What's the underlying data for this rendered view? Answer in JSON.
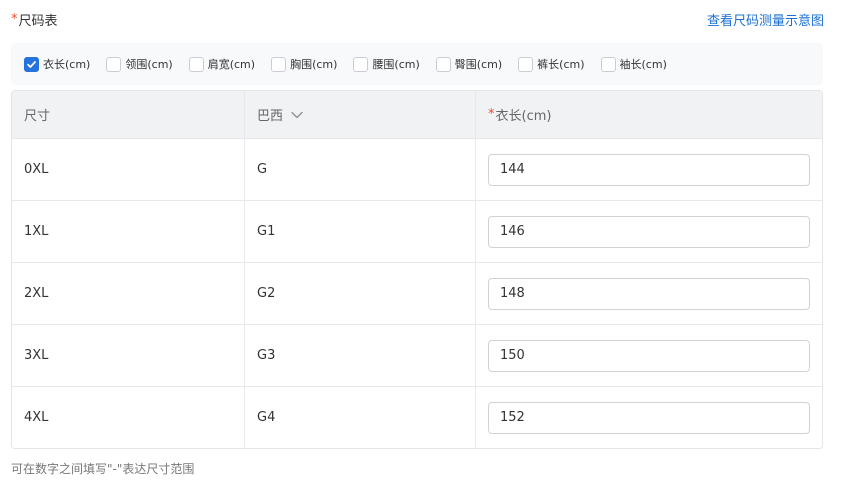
{
  "header": {
    "required_mark": "*",
    "title": "尺码表",
    "help_link": "查看尺码测量示意图"
  },
  "measures": [
    {
      "label": "衣长(cm)",
      "checked": true
    },
    {
      "label": "领围(cm)",
      "checked": false
    },
    {
      "label": "肩宽(cm)",
      "checked": false
    },
    {
      "label": "胸围(cm)",
      "checked": false
    },
    {
      "label": "腰围(cm)",
      "checked": false
    },
    {
      "label": "臀围(cm)",
      "checked": false
    },
    {
      "label": "裤长(cm)",
      "checked": false
    },
    {
      "label": "袖长(cm)",
      "checked": false
    }
  ],
  "table": {
    "columns": {
      "size": "尺寸",
      "region": "巴西",
      "required_mark": "*",
      "length": "衣长(cm)"
    },
    "rows": [
      {
        "size": "0XL",
        "region": "G",
        "length": "144"
      },
      {
        "size": "1XL",
        "region": "G1",
        "length": "146"
      },
      {
        "size": "2XL",
        "region": "G2",
        "length": "148"
      },
      {
        "size": "3XL",
        "region": "G3",
        "length": "150"
      },
      {
        "size": "4XL",
        "region": "G4",
        "length": "152"
      }
    ]
  },
  "hint": "可在数字之间填写\"-\"表达尺寸范围",
  "colors": {
    "accent": "#2673dd",
    "link": "#1a6fd3",
    "required": "#ee4d2d"
  }
}
